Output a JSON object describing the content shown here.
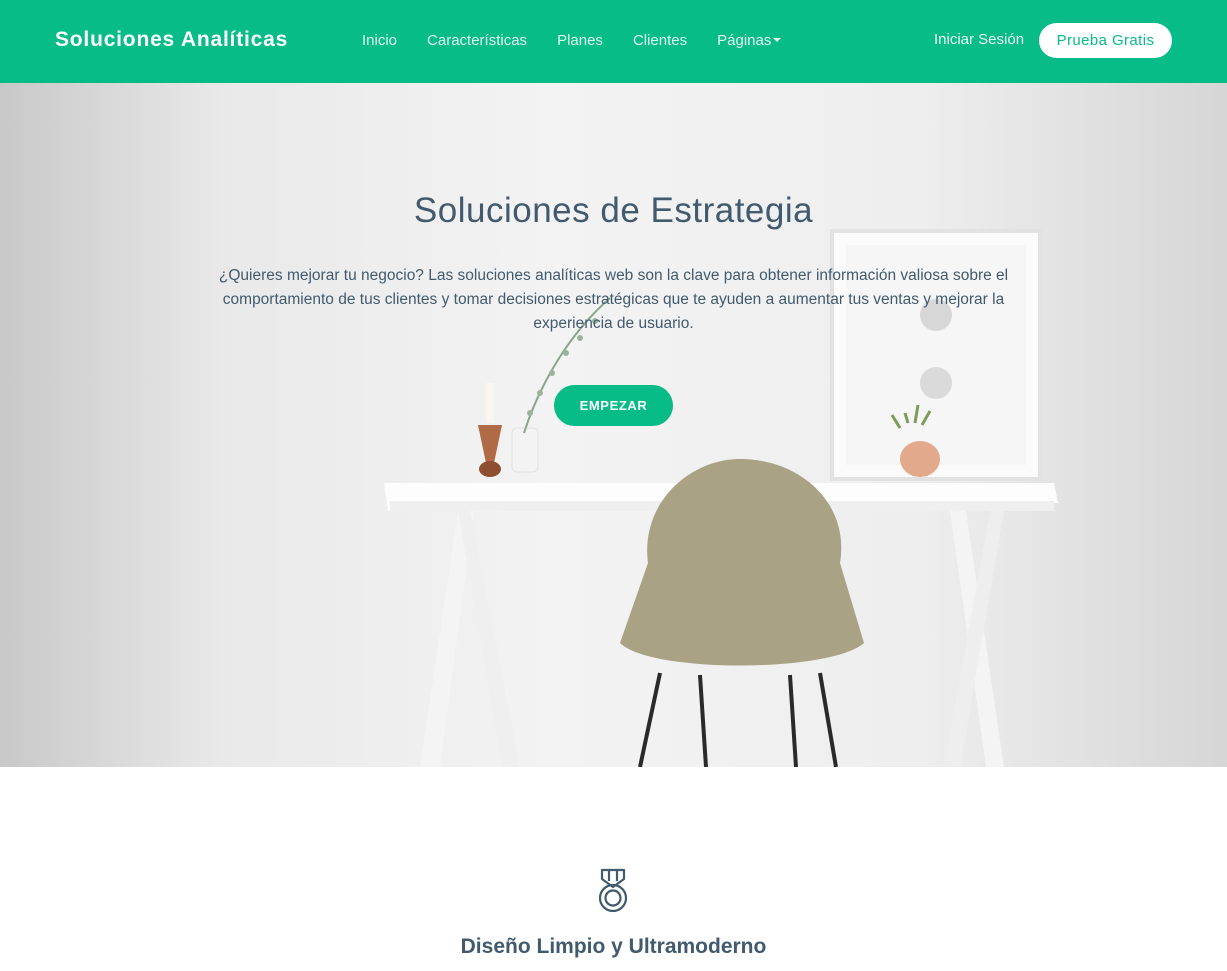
{
  "navbar": {
    "brand": "Soluciones Analíticas",
    "links": [
      "Inicio",
      "Características",
      "Planes",
      "Clientes",
      "Páginas"
    ],
    "login_label": "Iniciar Sesión",
    "trial_label": "Prueba Gratis"
  },
  "hero": {
    "title": "Soluciones de Estrategia",
    "description": "¿Quieres mejorar tu negocio? Las soluciones analíticas web son la clave para obtener información valiosa sobre el comportamiento de tus clientes y tomar decisiones estratégicas que te ayuden a aumentar tus ventas y mejorar la experiencia de usuario.",
    "cta_label": "EMPEZAR"
  },
  "feature": {
    "icon": "medal-icon",
    "title": "Diseño Limpio y Ultramoderno"
  },
  "colors": {
    "brand_green": "#07bc87",
    "text_dark": "#415a6e",
    "white": "#ffffff"
  }
}
